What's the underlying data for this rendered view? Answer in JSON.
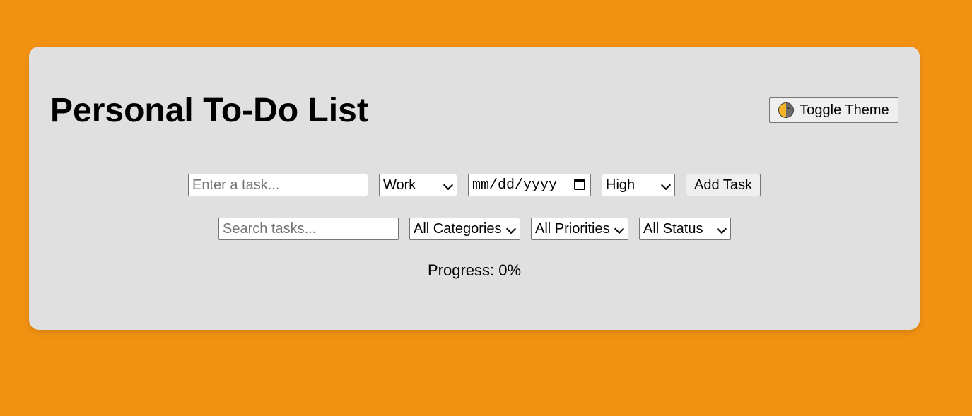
{
  "app": {
    "title": "Personal To-Do List",
    "theme_button_label": "Toggle Theme",
    "theme_icon": "half-moon-icon"
  },
  "colors": {
    "background": "#f39212",
    "card": "#e0e0e0"
  },
  "add_form": {
    "task_placeholder": "Enter a task...",
    "task_value": "",
    "category_selected": "Work",
    "category_options": [
      "Work"
    ],
    "date_placeholder": "mm/dd/yyyy",
    "priority_selected": "High",
    "priority_options": [
      "High"
    ],
    "add_button_label": "Add Task"
  },
  "filters": {
    "search_placeholder": "Search tasks...",
    "search_value": "",
    "category_filter_selected": "All Categories",
    "priority_filter_selected": "All Priorities",
    "status_filter_selected": "All Status"
  },
  "progress": {
    "text": "Progress: 0%",
    "percent": 0
  }
}
